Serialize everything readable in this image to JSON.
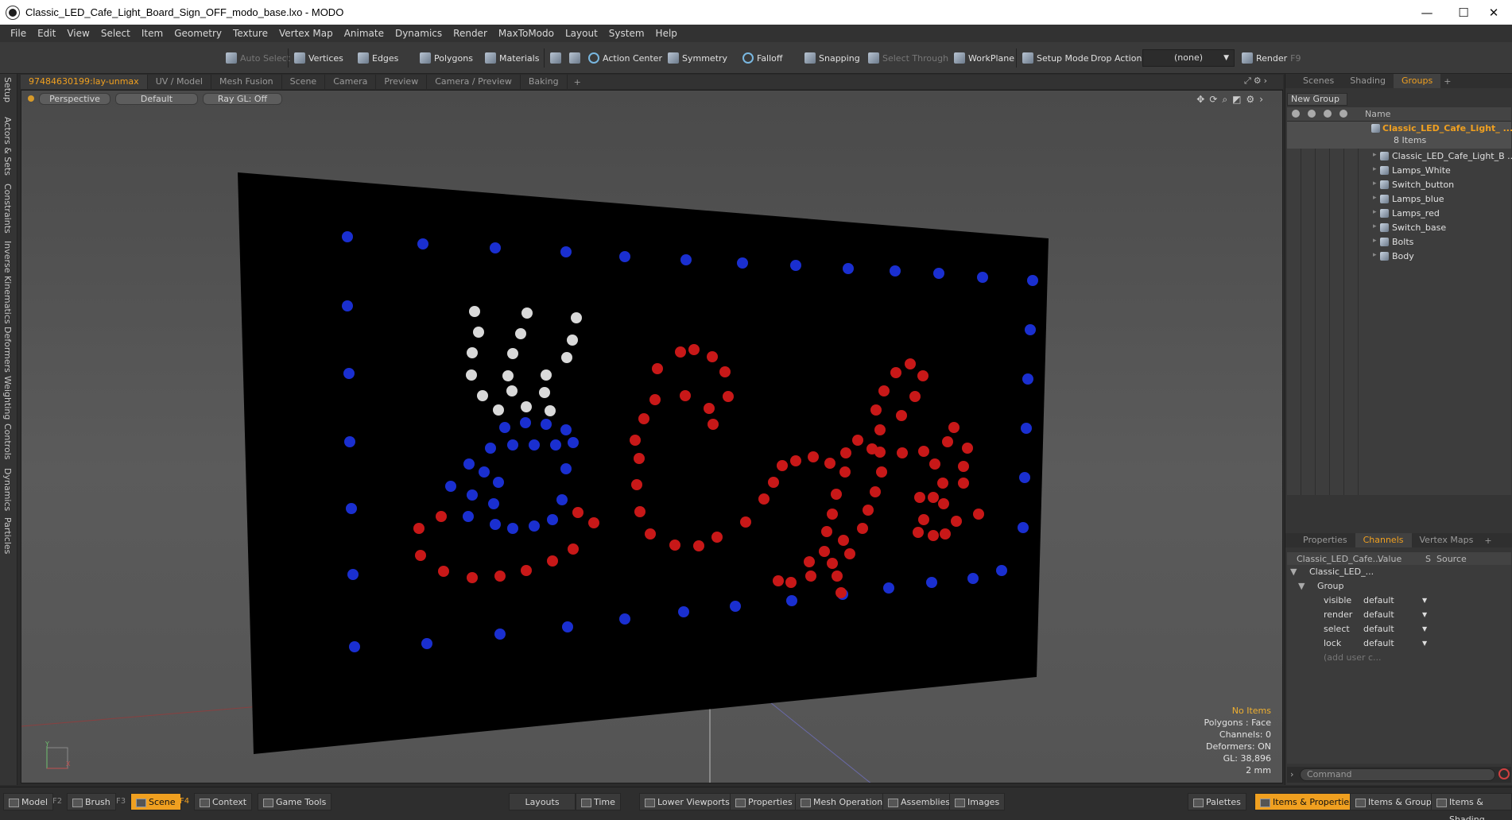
{
  "window": {
    "title": "Classic_LED_Cafe_Light_Board_Sign_OFF_modo_base.lxo - MODO",
    "minimize": "—",
    "maximize": "☐",
    "close": "✕"
  },
  "menu": [
    "File",
    "Edit",
    "View",
    "Select",
    "Item",
    "Geometry",
    "Texture",
    "Vertex Map",
    "Animate",
    "Dynamics",
    "Render",
    "MaxToModo",
    "Layout",
    "System",
    "Help"
  ],
  "toolbar": {
    "auto_select": "Auto Select",
    "vertices": "Vertices",
    "edges": "Edges",
    "polygons": "Polygons",
    "materials": "Materials",
    "action_center": "Action Center",
    "symmetry": "Symmetry",
    "falloff": "Falloff",
    "snapping": "Snapping",
    "select_through": "Select Through",
    "workplane": "WorkPlane",
    "setup_mode": "Setup Mode",
    "drop_action": "Drop Action",
    "drop_value": "(none)",
    "render": "Render",
    "render_key": "F9"
  },
  "left_tabs": [
    "Setup",
    "Actors & Sets",
    "Constraints",
    "Inverse Kinematics",
    "Deformers",
    "Weighting",
    "Controls",
    "Dynamics",
    "Particles"
  ],
  "viewport_tabs": [
    "97484630199:lay-unmax",
    "UV / Model",
    "Mesh Fusion",
    "Scene",
    "Camera",
    "Preview",
    "Camera / Preview",
    "Baking"
  ],
  "viewport": {
    "view_mode": "Perspective",
    "shading": "Default",
    "raygl": "Ray GL: Off",
    "axis_y": "Y",
    "axis_x": "X",
    "info": {
      "selection": "No Items",
      "polygons": "Polygons : Face",
      "channels": "Channels: 0",
      "deformers": "Deformers: ON",
      "gl": "GL: 38,896",
      "unit": "2 mm"
    }
  },
  "groups_panel": {
    "tabs": [
      "Scenes",
      "Shading",
      "Groups"
    ],
    "new_group": "New Group",
    "col_name": "Name",
    "group_name": "Classic_LED_Cafe_Light_ ...",
    "group_count": "8 Items",
    "items": [
      "Classic_LED_Cafe_Light_B ...",
      "Lamps_White",
      "Switch_button",
      "Lamps_blue",
      "Lamps_red",
      "Switch_base",
      "Bolts",
      "Body"
    ]
  },
  "channels_panel": {
    "tabs": [
      "Properties",
      "Channels",
      "Vertex Maps"
    ],
    "headers": {
      "name": "Classic_LED_Cafe...",
      "value": "Value",
      "s": "S",
      "source": "Source"
    },
    "root": "Classic_LED_...",
    "group": "Group",
    "rows": [
      {
        "name": "visible",
        "value": "default"
      },
      {
        "name": "render",
        "value": "default"
      },
      {
        "name": "select",
        "value": "default"
      },
      {
        "name": "lock",
        "value": "default"
      }
    ],
    "add_user": "(add user c..."
  },
  "command": {
    "placeholder": "Command"
  },
  "bottom": {
    "model": "Model",
    "model_key": "F2",
    "brush": "Brush",
    "brush_key": "F3",
    "scene": "Scene",
    "scene_key": "F4",
    "context": "Context",
    "game_tools": "Game Tools",
    "layouts": "Layouts",
    "time": "Time",
    "lower_viewports": "Lower Viewports",
    "properties": "Properties",
    "mesh_operations": "Mesh Operations",
    "assemblies": "Assemblies",
    "images": "Images",
    "palettes": "Palettes",
    "items_properties": "Items & Properties",
    "items_groups": "Items & Groups",
    "items_shading": "Items & Shading"
  },
  "colors": {
    "accent": "#f0a020",
    "led_blue": "#1a2fd0",
    "led_red": "#c81818",
    "led_white": "#d9d9d9",
    "board": "#000000"
  }
}
